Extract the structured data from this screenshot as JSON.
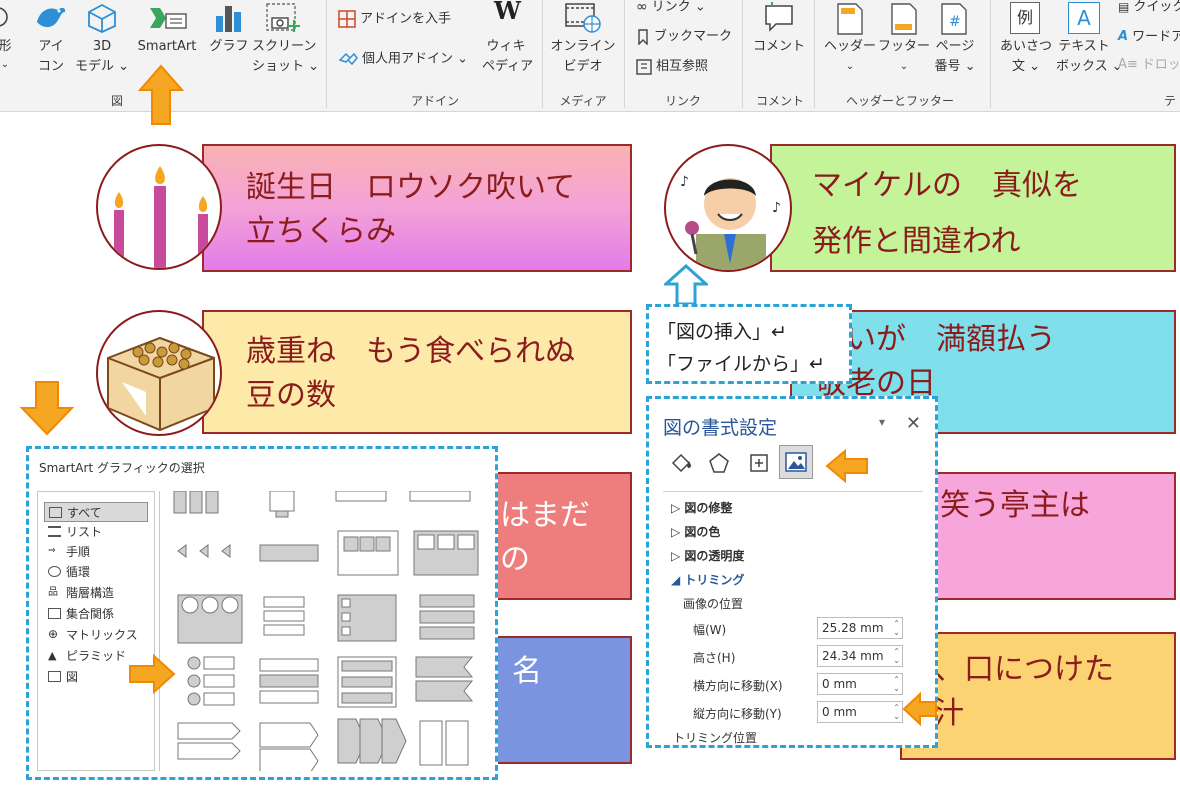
{
  "ribbon": {
    "illustrations": {
      "shapes_label": "形",
      "icons_label1": "アイ",
      "icons_label2": "コン",
      "model3d_label1": "3D",
      "model3d_label2": "モデル",
      "smartart_label": "SmartArt",
      "chart_label": "グラフ",
      "screenshot_label1": "スクリーン",
      "screenshot_label2": "ショット",
      "group_label": "図"
    },
    "addins": {
      "get_addins": "アドインを入手",
      "my_addins": "個人用アドイン",
      "wiki_label1": "ウィキ",
      "wiki_label2": "ペディア",
      "wiki_glyph": "W",
      "group_label": "アドイン"
    },
    "media": {
      "online_video1": "オンライン",
      "online_video2": "ビデオ",
      "group_label": "メディア"
    },
    "links": {
      "link": "リンク",
      "bookmark": "ブックマーク",
      "cross_ref": "相互参照",
      "group_label": "リンク"
    },
    "comments": {
      "comment": "コメント",
      "group_label": "コメント"
    },
    "header_footer": {
      "header": "ヘッダー",
      "footer": "フッター",
      "page_num1": "ページ",
      "page_num2": "番号",
      "page_glyph": "#",
      "group_label": "ヘッダーとフッター"
    },
    "text": {
      "greeting1": "あいさつ",
      "greeting2": "文",
      "greeting_glyph": "例",
      "textbox1": "テキスト",
      "textbox2": "ボックス",
      "textbox_glyph": "A",
      "quickparts": "クイック",
      "wordart": "ワードア",
      "dropcap": "ドロップ",
      "group_label": "テ"
    }
  },
  "cards": [
    {
      "line1": "誕生日　ロウソク吹いて",
      "line2": "立ちくらみ"
    },
    {
      "line1": "マイケルの　真似を",
      "line2": "発作と間違われ"
    },
    {
      "line1": "歳重ね　もう食べられぬ",
      "line2": "豆の数"
    },
    {
      "line1": "ないが　満額払う",
      "line2": "敬老の日"
    },
    {
      "line1": "はまだ",
      "line2": "の"
    },
    {
      "line1": "笑う亭主は",
      "line2": ""
    },
    {
      "line1": "名",
      "line2": ""
    },
    {
      "line1": "、口につけた",
      "line2": "汁"
    }
  ],
  "tooltip": {
    "line1": "「図の挿入」↵",
    "line2": "「ファイルから」↵"
  },
  "smartart_dialog": {
    "title": "SmartArt グラフィックの選択",
    "categories": [
      "すべて",
      "リスト",
      "手順",
      "循環",
      "階層構造",
      "集合関係",
      "マトリックス",
      "ピラミッド",
      "図"
    ]
  },
  "format_pane": {
    "title": "図の書式設定",
    "sections": [
      "図の修整",
      "図の色",
      "図の透明度",
      "トリミング"
    ],
    "sub_heading": "画像の位置",
    "rows": [
      {
        "label": "幅(W)",
        "value": "25.28 mm"
      },
      {
        "label": "高さ(H)",
        "value": "24.34 mm"
      },
      {
        "label": "横方向に移動(X)",
        "value": "0 mm"
      },
      {
        "label": "縦方向に移動(Y)",
        "value": "0 mm"
      }
    ],
    "footer_heading": "トリミング位置"
  },
  "colors": {
    "accent_orange": "#f5a623",
    "dash_blue": "#2ba3d6",
    "text_red": "#8a1c1c",
    "ribbon_bg": "#f3f3f3"
  }
}
